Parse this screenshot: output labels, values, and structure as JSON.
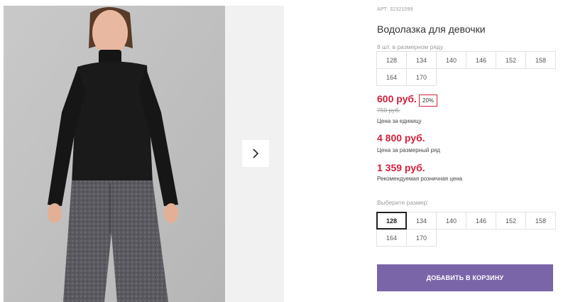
{
  "product": {
    "article_label": "АРТ:",
    "article_number": "32321099",
    "title": "Водолазка для девочки",
    "series_note": "8 шт. в размерном ряду"
  },
  "series_sizes": [
    "128",
    "134",
    "140",
    "146",
    "152",
    "158",
    "164",
    "170"
  ],
  "pricing": {
    "unit_price": "600 руб.",
    "discount": "20%",
    "old_price": "750 руб.",
    "unit_label": "Цена за единицу",
    "series_price": "4 800 руб.",
    "series_label": "Цена за размерный ряд",
    "rrp_price": "1 359 руб.",
    "rrp_label": "Рекомендуемая розничная цена"
  },
  "size_picker": {
    "label": "Выберите размер:",
    "sizes": [
      "128",
      "134",
      "140",
      "146",
      "152",
      "158",
      "164",
      "170"
    ],
    "selected": "128"
  },
  "actions": {
    "add_to_cart": "ДОБАВИТЬ В КОРЗИНУ"
  },
  "gallery": {
    "next_icon": "chevron-right-icon"
  },
  "colors": {
    "price_red": "#d21f3c",
    "button_purple": "#7b65a9"
  }
}
